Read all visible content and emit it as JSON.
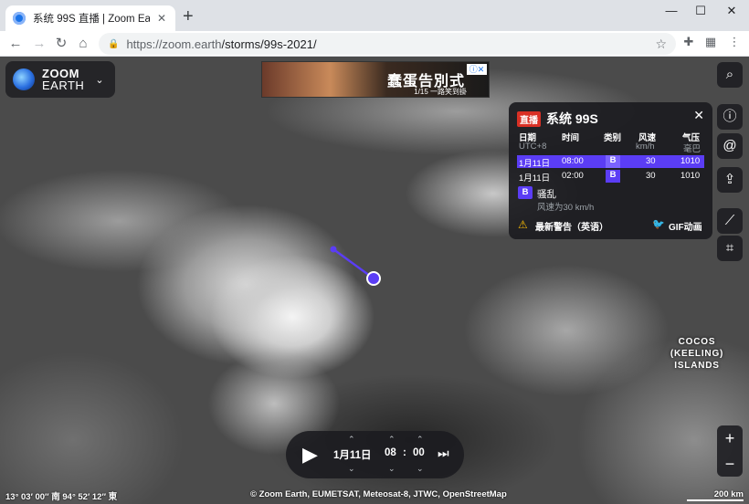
{
  "browser": {
    "tab_title": "系统 99S 直播 | Zoom Earth",
    "tab_close": "✕",
    "new_tab": "+",
    "url_host": "https://zoom.earth",
    "url_path": "/storms/99s-2021/",
    "window_controls": [
      "—",
      "☐",
      "✕"
    ]
  },
  "logo": {
    "line1": "ZOOM",
    "line2": "EARTH"
  },
  "ad": {
    "title": "蠢蛋告別式",
    "subtitle": "1/15 一路笑到掛",
    "badge": "ⓘ✕"
  },
  "storm_panel": {
    "live_badge": "直播",
    "name": "系统 99S",
    "columns": {
      "date": "日期",
      "time": "时间",
      "category": "类别",
      "wind": "风速",
      "pressure": "气压"
    },
    "subcolumns": {
      "tz": "UTC+8",
      "wind_unit": "km/h",
      "pressure_unit": "毫巴"
    },
    "rows": [
      {
        "date": "1月11日",
        "time": "08:00",
        "category": "B",
        "wind": "30",
        "pressure": "1010"
      },
      {
        "date": "1月11日",
        "time": "02:00",
        "category": "B",
        "wind": "30",
        "pressure": "1010"
      }
    ],
    "legend": {
      "code": "B",
      "name": "骚乱",
      "desc": "风速为30 km/h"
    },
    "warning": "最新警告（英语）",
    "gif": "GIF动画"
  },
  "map_label": {
    "line1": "COCOS",
    "line2": "(KEELING)",
    "line3": "ISLANDS"
  },
  "player": {
    "date": "1月11日",
    "hour": "08",
    "minute": "00",
    "colon": ":"
  },
  "footer": {
    "coords": "13° 03′ 00″ 南   94° 52′ 12″ 東",
    "credits": "© Zoom Earth, EUMETSAT, Meteosat-8, JTWC, OpenStreetMap",
    "scale": "200 km"
  },
  "colors": {
    "accent": "#5b3df5",
    "live": "#d93025",
    "warning": "#fbbc04",
    "twitter": "#1da1f2"
  }
}
